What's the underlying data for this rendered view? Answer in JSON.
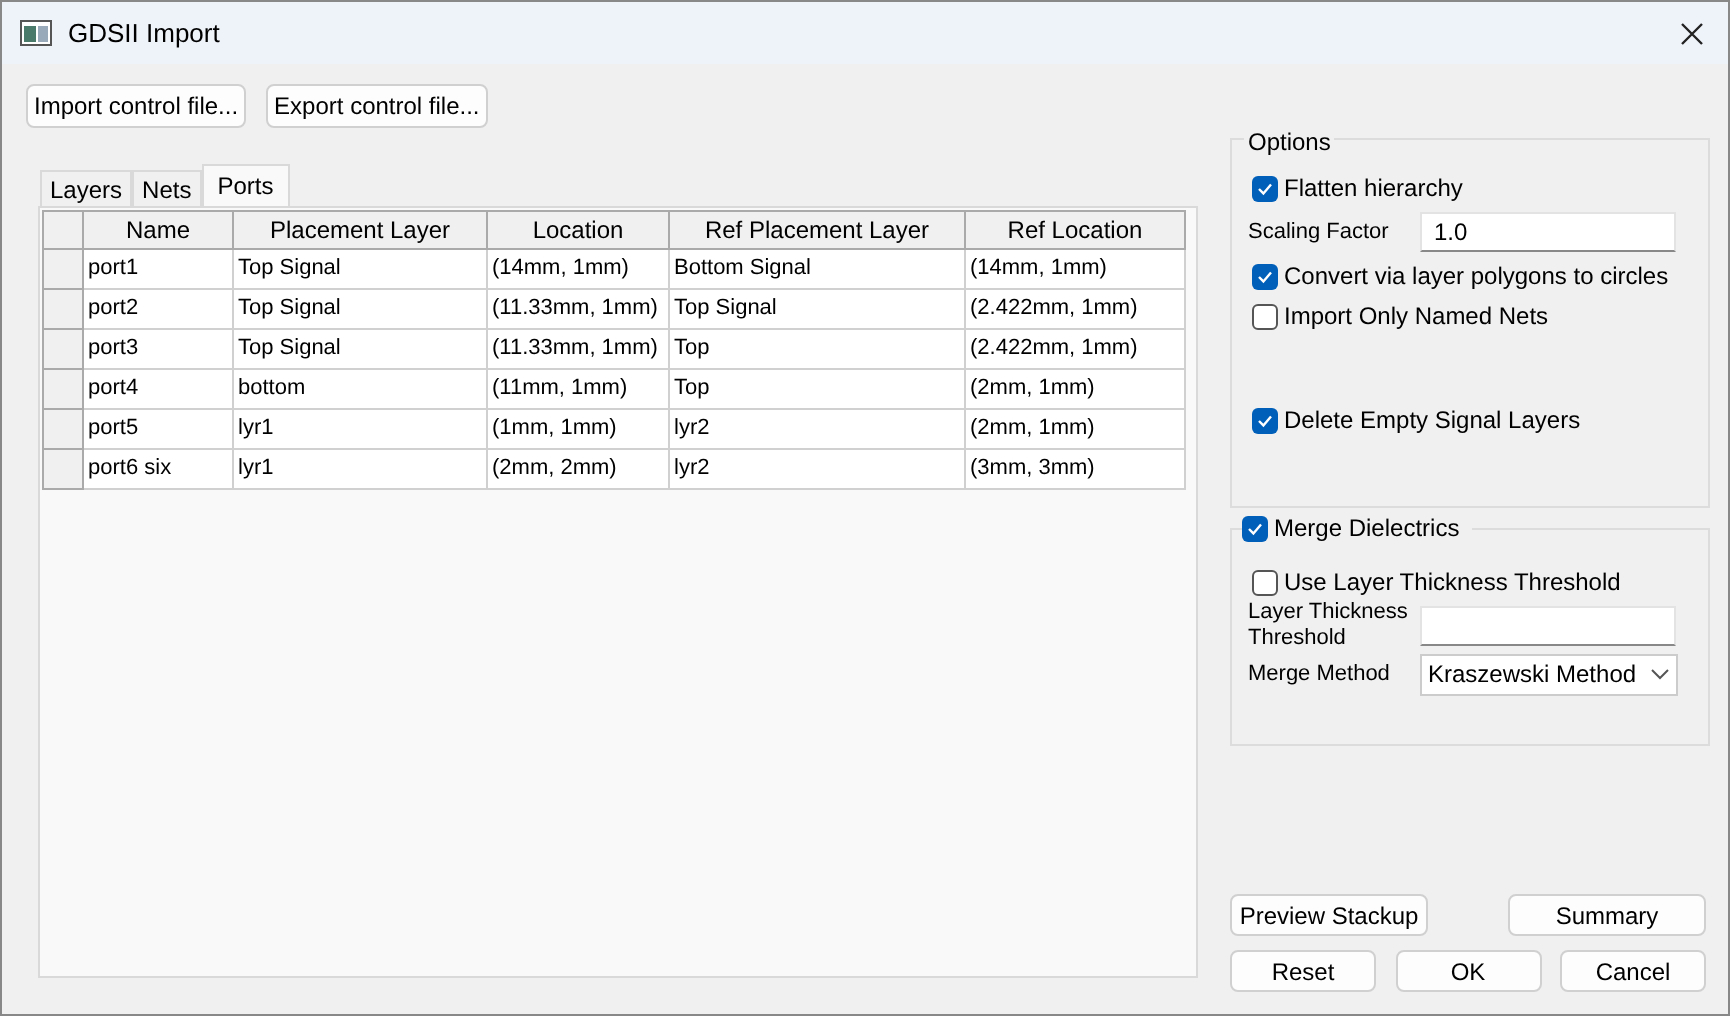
{
  "window": {
    "title": "GDSII Import"
  },
  "file_buttons": [
    "Import control file...",
    "Export control file..."
  ],
  "tabs": [
    {
      "label": "Layers",
      "selected": false
    },
    {
      "label": "Nets",
      "selected": false
    },
    {
      "label": "Ports",
      "selected": true
    }
  ],
  "table": {
    "columns": [
      "Name",
      "Placement Layer",
      "Location",
      "Ref Placement Layer",
      "Ref Location"
    ],
    "rows": [
      [
        "port1",
        "Top Signal",
        "(14mm, 1mm)",
        "Bottom Signal",
        "(14mm, 1mm)"
      ],
      [
        "port2",
        "Top Signal",
        "(11.33mm, 1mm)",
        "Top Signal",
        "(2.422mm, 1mm)"
      ],
      [
        "port3",
        "Top Signal",
        "(11.33mm, 1mm)",
        "Top",
        "(2.422mm, 1mm)"
      ],
      [
        "port4",
        "bottom",
        "(11mm, 1mm)",
        "Top",
        "(2mm, 1mm)"
      ],
      [
        "port5",
        "lyr1",
        "(1mm, 1mm)",
        "lyr2",
        "(2mm, 1mm)"
      ],
      [
        "port6 six",
        "lyr1",
        "(2mm, 2mm)",
        "lyr2",
        "(3mm, 3mm)"
      ]
    ]
  },
  "options": {
    "title": "Options",
    "items": [
      {
        "kind": "checkbox",
        "label": "Flatten hierarchy",
        "checked": true
      },
      {
        "kind": "field",
        "label": "Scaling Factor",
        "value": "1.0"
      },
      {
        "kind": "checkbox",
        "label": "Convert via layer polygons to circles",
        "checked": true
      },
      {
        "kind": "checkbox",
        "label": "Import Only Named Nets",
        "checked": false
      },
      {
        "kind": "spacer"
      },
      {
        "kind": "checkbox",
        "label": "Delete Empty Signal Layers",
        "checked": true
      }
    ]
  },
  "merge": {
    "title": "Merge Dielectrics",
    "checked": true,
    "items": [
      {
        "kind": "checkbox",
        "label": "Use Layer Thickness Threshold",
        "checked": false
      },
      {
        "kind": "field",
        "label": "Layer Thickness Threshold"
      },
      {
        "kind": "dropdown",
        "label": "Merge Method",
        "value": "Kraszewski Method"
      }
    ]
  },
  "side_buttons": [
    "Preview Stackup",
    "Summary"
  ],
  "dialog_buttons": [
    "Reset",
    "OK",
    "Cancel"
  ]
}
